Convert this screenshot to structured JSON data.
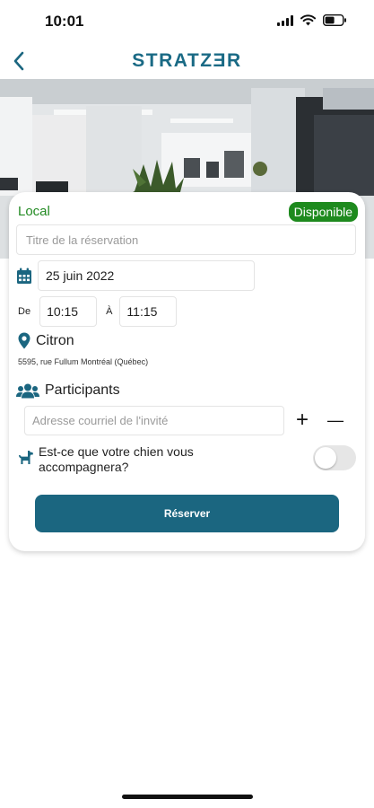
{
  "status_bar": {
    "time": "10:01"
  },
  "header": {
    "brand": "STRATZƎR",
    "back_icon": "chevron-left-icon"
  },
  "card": {
    "room_label": "Local",
    "status_badge": "Disponible",
    "title_placeholder": "Titre de la réservation",
    "date": "25 juin 2022",
    "time_from_label": "De",
    "time_from": "10:15",
    "time_to_label": "À",
    "time_to": "11:15",
    "location_name": "Citron",
    "location_address": "5595, rue Fullum Montréal  (Québec)",
    "participants_label": "Participants",
    "email_placeholder": "Adresse courriel de l'invité",
    "add_symbol": "+",
    "remove_symbol": "—",
    "dog_question": "Est-ce que votre chien vous accompagnera?",
    "dog_toggle_on": false,
    "reserve_label": "Réserver"
  },
  "colors": {
    "brand": "#1a6a85",
    "local_green": "#238b23",
    "badge_green": "#1e8a1e",
    "button_blue": "#1b6680",
    "icon_blue": "#1b6680"
  }
}
